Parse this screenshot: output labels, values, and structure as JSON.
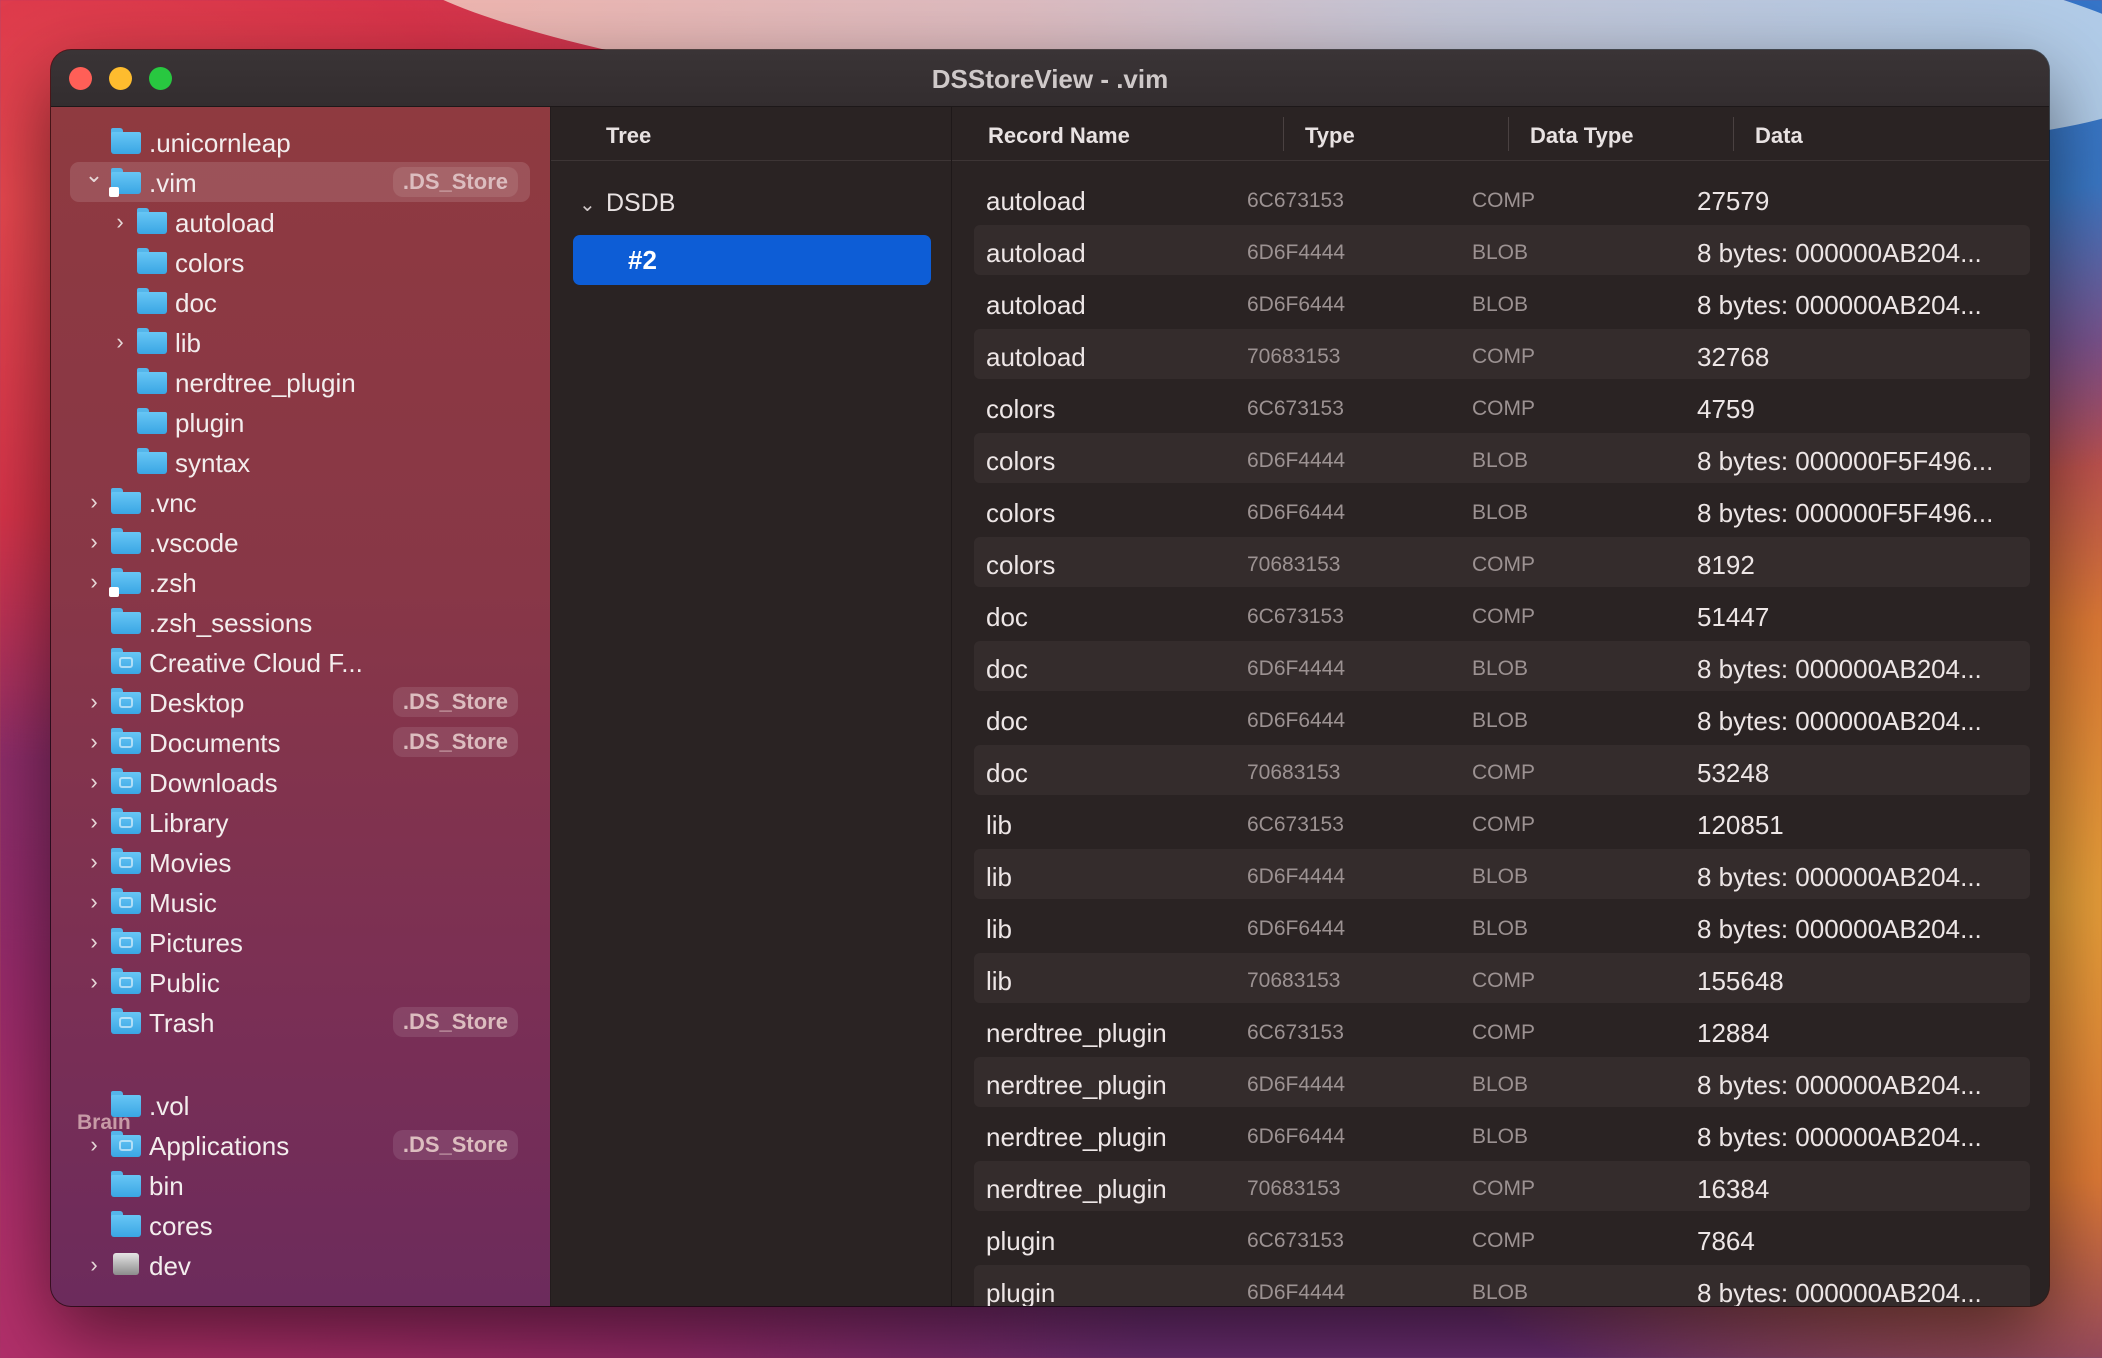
{
  "window": {
    "title": "DSStoreView - .vim"
  },
  "sidebar": {
    "items": [
      {
        "label": ".unicornleap",
        "indent": 0,
        "chevron": "",
        "icon": "folder-icon",
        "badge": ""
      },
      {
        "label": ".vim",
        "indent": 0,
        "chevron": "expanded",
        "icon": "folder-alias-icon",
        "badge": ".DS_Store",
        "selected": true
      },
      {
        "label": "autoload",
        "indent": 1,
        "chevron": "collapsed",
        "icon": "folder-icon",
        "badge": ""
      },
      {
        "label": "colors",
        "indent": 1,
        "chevron": "",
        "icon": "folder-icon",
        "badge": ""
      },
      {
        "label": "doc",
        "indent": 1,
        "chevron": "",
        "icon": "folder-icon",
        "badge": ""
      },
      {
        "label": "lib",
        "indent": 1,
        "chevron": "collapsed",
        "icon": "folder-icon",
        "badge": ""
      },
      {
        "label": "nerdtree_plugin",
        "indent": 1,
        "chevron": "",
        "icon": "folder-icon",
        "badge": ""
      },
      {
        "label": "plugin",
        "indent": 1,
        "chevron": "",
        "icon": "folder-icon",
        "badge": ""
      },
      {
        "label": "syntax",
        "indent": 1,
        "chevron": "",
        "icon": "folder-icon",
        "badge": ""
      },
      {
        "label": ".vnc",
        "indent": 0,
        "chevron": "collapsed",
        "icon": "folder-icon",
        "badge": ""
      },
      {
        "label": ".vscode",
        "indent": 0,
        "chevron": "collapsed",
        "icon": "folder-icon",
        "badge": ""
      },
      {
        "label": ".zsh",
        "indent": 0,
        "chevron": "collapsed",
        "icon": "folder-alias-icon",
        "badge": ""
      },
      {
        "label": ".zsh_sessions",
        "indent": 0,
        "chevron": "",
        "icon": "folder-icon",
        "badge": ""
      },
      {
        "label": "Creative Cloud F...",
        "indent": 0,
        "chevron": "",
        "icon": "creative-cloud-folder-icon",
        "badge": ""
      },
      {
        "label": "Desktop",
        "indent": 0,
        "chevron": "collapsed",
        "icon": "desktop-folder-icon",
        "badge": ".DS_Store"
      },
      {
        "label": "Documents",
        "indent": 0,
        "chevron": "collapsed",
        "icon": "documents-folder-icon",
        "badge": ".DS_Store"
      },
      {
        "label": "Downloads",
        "indent": 0,
        "chevron": "collapsed",
        "icon": "downloads-folder-icon",
        "badge": ""
      },
      {
        "label": "Library",
        "indent": 0,
        "chevron": "collapsed",
        "icon": "library-folder-icon",
        "badge": ""
      },
      {
        "label": "Movies",
        "indent": 0,
        "chevron": "collapsed",
        "icon": "movies-folder-icon",
        "badge": ""
      },
      {
        "label": "Music",
        "indent": 0,
        "chevron": "collapsed",
        "icon": "music-folder-icon",
        "badge": ""
      },
      {
        "label": "Pictures",
        "indent": 0,
        "chevron": "collapsed",
        "icon": "pictures-folder-icon",
        "badge": ""
      },
      {
        "label": "Public",
        "indent": 0,
        "chevron": "collapsed",
        "icon": "public-folder-icon",
        "badge": ""
      },
      {
        "label": "Trash",
        "indent": 0,
        "chevron": "",
        "icon": "trash-folder-icon",
        "badge": ".DS_Store"
      }
    ],
    "section": "Brain",
    "section_items": [
      {
        "label": ".vol",
        "indent": 0,
        "chevron": "",
        "icon": "folder-icon",
        "badge": ""
      },
      {
        "label": "Applications",
        "indent": 0,
        "chevron": "collapsed",
        "icon": "applications-folder-icon",
        "badge": ".DS_Store"
      },
      {
        "label": "bin",
        "indent": 0,
        "chevron": "",
        "icon": "folder-icon",
        "badge": ""
      },
      {
        "label": "cores",
        "indent": 0,
        "chevron": "",
        "icon": "folder-icon",
        "badge": ""
      },
      {
        "label": "dev",
        "indent": 0,
        "chevron": "collapsed",
        "icon": "disk-icon",
        "badge": ""
      }
    ]
  },
  "tree": {
    "header": "Tree",
    "root": "DSDB",
    "selected_child": "#2"
  },
  "table": {
    "headers": [
      "Record Name",
      "Type",
      "Data Type",
      "Data"
    ],
    "rows": [
      [
        "autoload",
        "6C673153",
        "COMP",
        "27579"
      ],
      [
        "autoload",
        "6D6F4444",
        "BLOB",
        "8 bytes: 000000AB204..."
      ],
      [
        "autoload",
        "6D6F6444",
        "BLOB",
        "8 bytes: 000000AB204..."
      ],
      [
        "autoload",
        "70683153",
        "COMP",
        "32768"
      ],
      [
        "colors",
        "6C673153",
        "COMP",
        "4759"
      ],
      [
        "colors",
        "6D6F4444",
        "BLOB",
        "8 bytes: 000000F5F496..."
      ],
      [
        "colors",
        "6D6F6444",
        "BLOB",
        "8 bytes: 000000F5F496..."
      ],
      [
        "colors",
        "70683153",
        "COMP",
        "8192"
      ],
      [
        "doc",
        "6C673153",
        "COMP",
        "51447"
      ],
      [
        "doc",
        "6D6F4444",
        "BLOB",
        "8 bytes: 000000AB204..."
      ],
      [
        "doc",
        "6D6F6444",
        "BLOB",
        "8 bytes: 000000AB204..."
      ],
      [
        "doc",
        "70683153",
        "COMP",
        "53248"
      ],
      [
        "lib",
        "6C673153",
        "COMP",
        "120851"
      ],
      [
        "lib",
        "6D6F4444",
        "BLOB",
        "8 bytes: 000000AB204..."
      ],
      [
        "lib",
        "6D6F6444",
        "BLOB",
        "8 bytes: 000000AB204..."
      ],
      [
        "lib",
        "70683153",
        "COMP",
        "155648"
      ],
      [
        "nerdtree_plugin",
        "6C673153",
        "COMP",
        "12884"
      ],
      [
        "nerdtree_plugin",
        "6D6F4444",
        "BLOB",
        "8 bytes: 000000AB204..."
      ],
      [
        "nerdtree_plugin",
        "6D6F6444",
        "BLOB",
        "8 bytes: 000000AB204..."
      ],
      [
        "nerdtree_plugin",
        "70683153",
        "COMP",
        "16384"
      ],
      [
        "plugin",
        "6C673153",
        "COMP",
        "7864"
      ],
      [
        "plugin",
        "6D6F4444",
        "BLOB",
        "8 bytes: 000000AB204..."
      ]
    ]
  },
  "colors": {
    "accent": "#0d5dd6",
    "close": "#ff5f57",
    "minimize": "#febc2e",
    "maximize": "#28c840",
    "folder": "#5bbcf0"
  }
}
